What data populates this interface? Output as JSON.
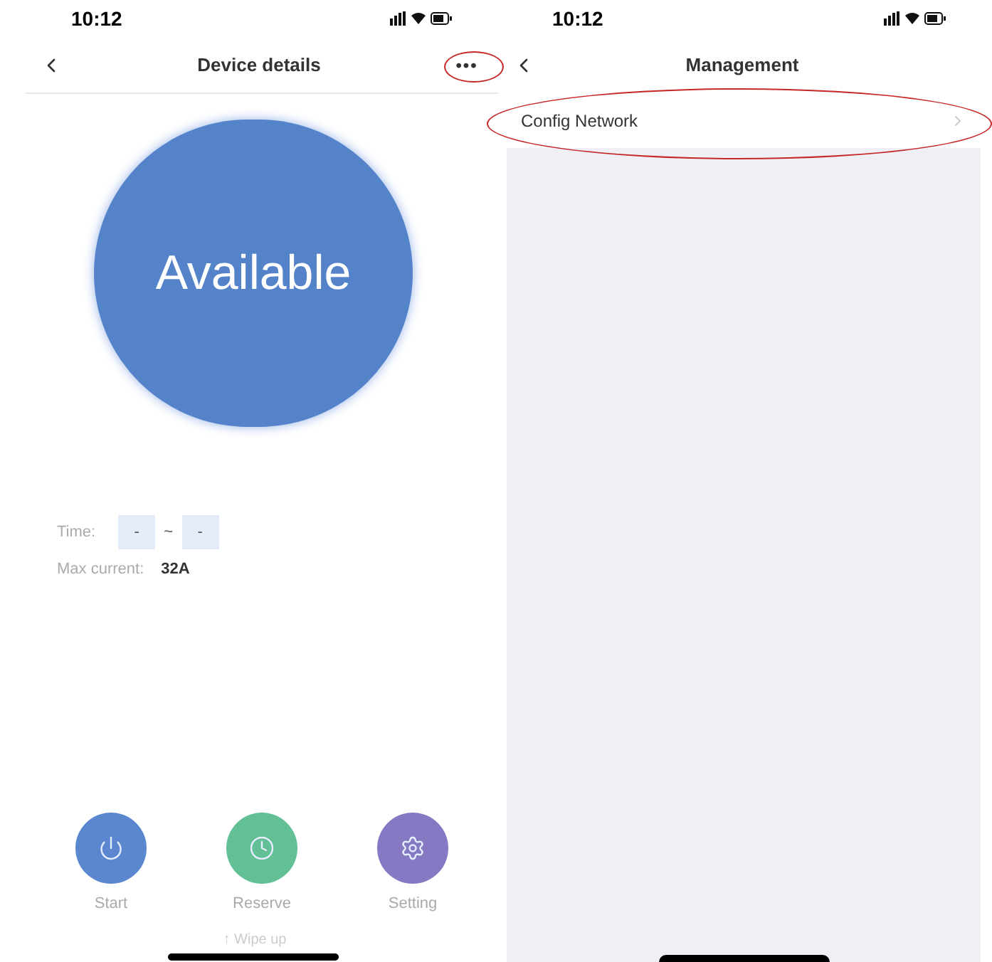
{
  "left_screen": {
    "status_time": "10:12",
    "title": "Device details",
    "more_button": "•••",
    "status_circle": "Available",
    "time_label": "Time:",
    "time_start": "-",
    "time_separator": "~",
    "time_end": "-",
    "max_current_label": "Max current:",
    "max_current_value": "32A",
    "actions": [
      {
        "kind": "power",
        "label": "Start",
        "color": "#5b87cf"
      },
      {
        "kind": "clock",
        "label": "Reserve",
        "color": "#62bf96"
      },
      {
        "kind": "gear",
        "label": "Setting",
        "color": "#8579c4"
      }
    ],
    "hint": "↑ Wipe up"
  },
  "right_screen": {
    "status_time": "10:12",
    "title": "Management",
    "items": [
      {
        "label": "Config Network"
      }
    ]
  }
}
